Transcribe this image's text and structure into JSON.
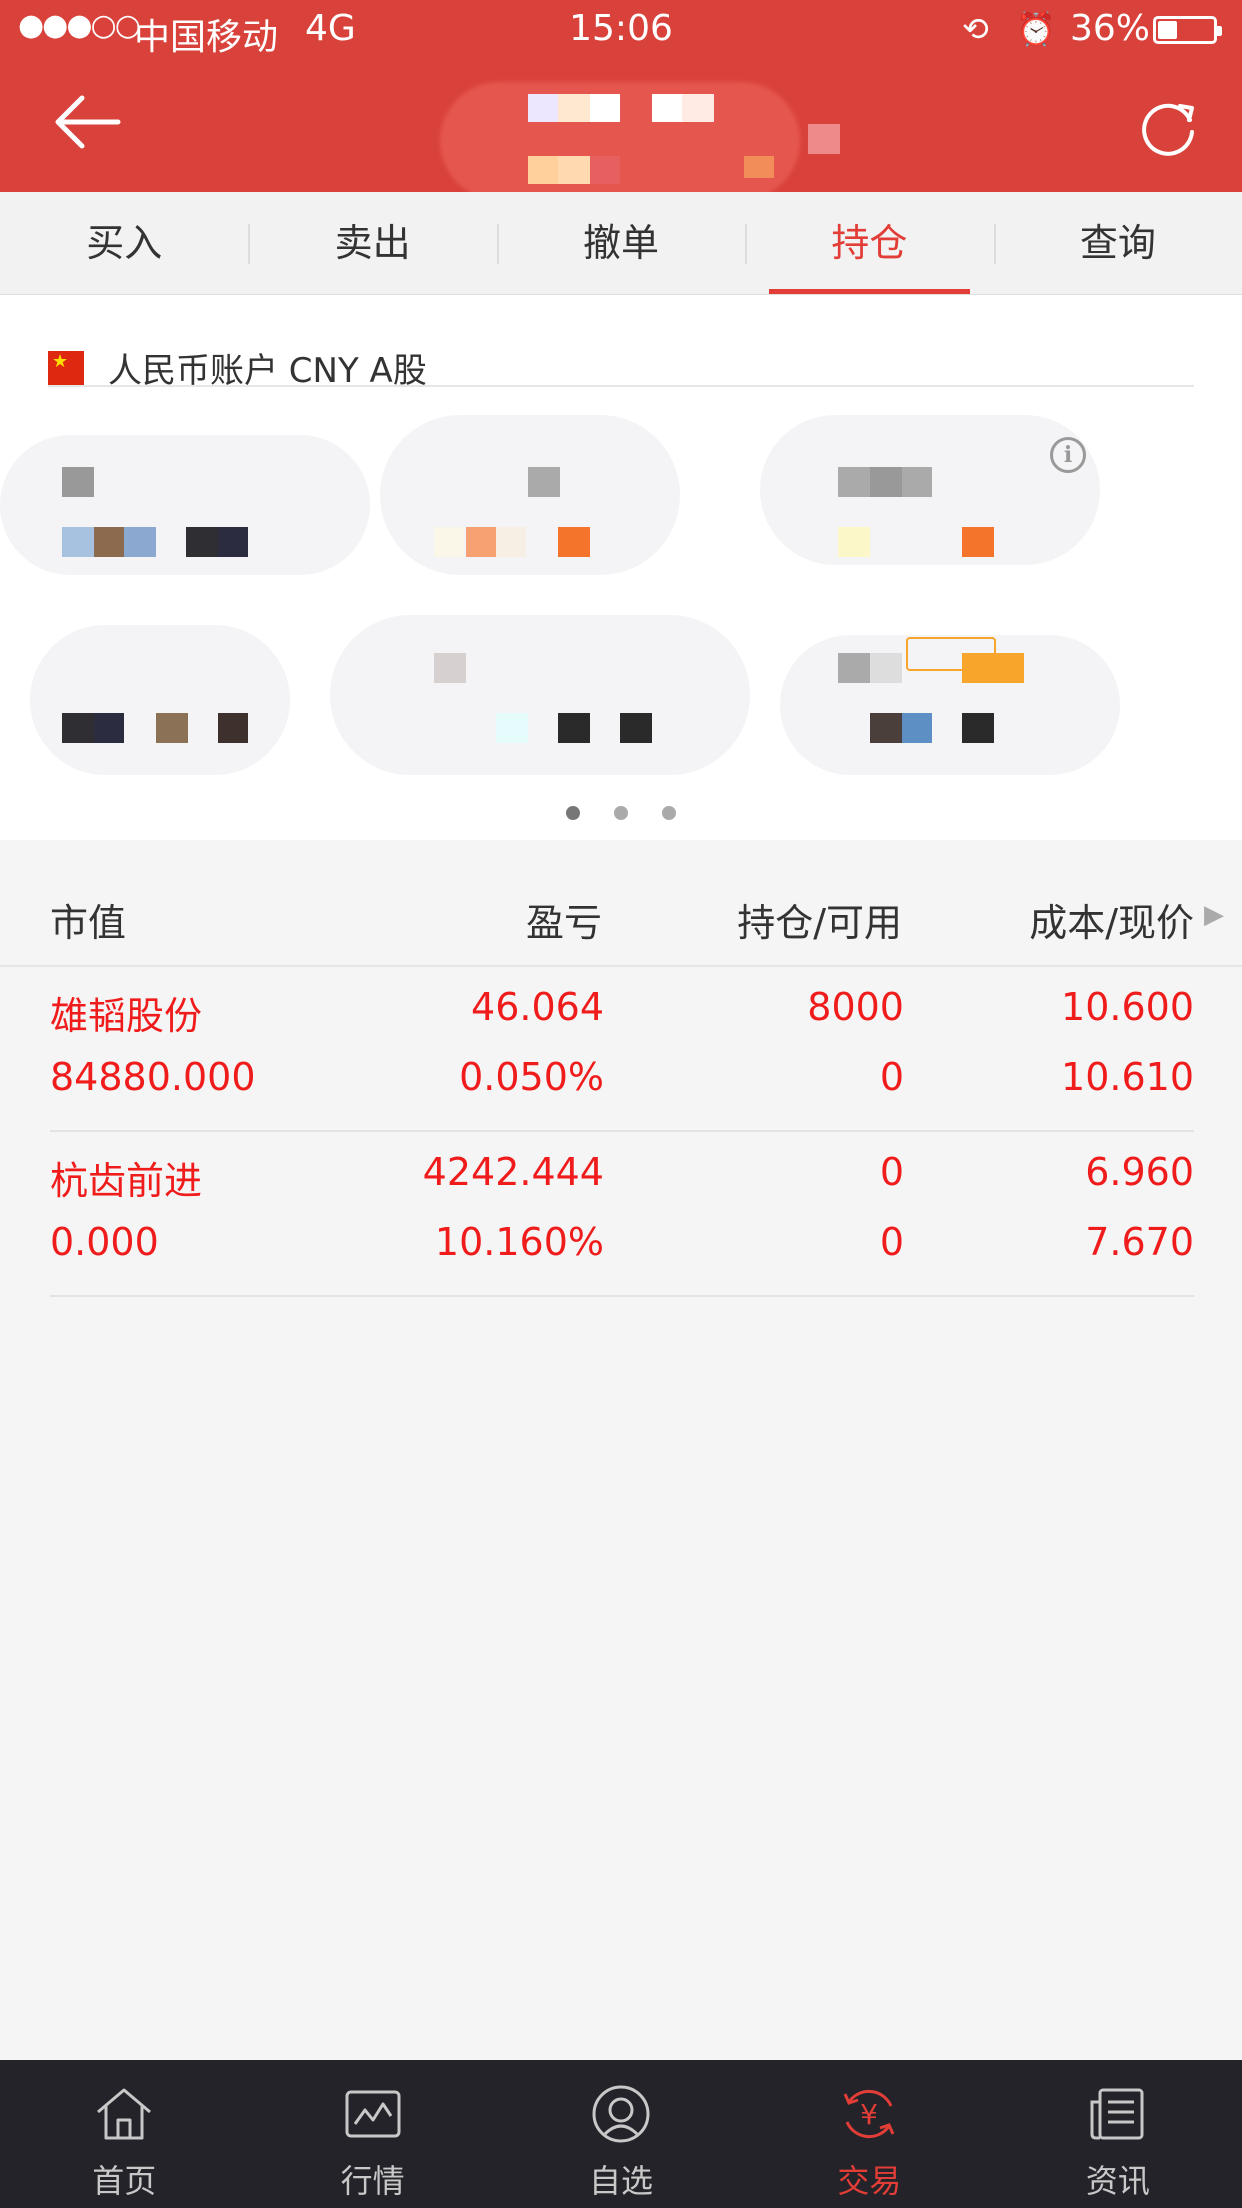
{
  "status_bar": {
    "signal": "●●●○○",
    "carrier": "中国移动",
    "network": "4G",
    "time": "15:06",
    "battery_percent": "36%",
    "battery_level": 0.36
  },
  "tabs": [
    {
      "label": "买入"
    },
    {
      "label": "卖出"
    },
    {
      "label": "撤单"
    },
    {
      "label": "持仓",
      "active": true
    },
    {
      "label": "查询"
    }
  ],
  "account": {
    "label": "人民币账户 CNY A股",
    "page_count": 3,
    "active_page": 1
  },
  "table": {
    "headers": [
      "市值",
      "盈亏",
      "持仓/可用",
      "成本/现价"
    ],
    "rows": [
      {
        "name": "雄韬股份",
        "market_value": "84880.000",
        "pnl": "46.064",
        "pnl_pct": "0.050%",
        "position": "8000",
        "available": "0",
        "cost": "10.600",
        "price": "10.610"
      },
      {
        "name": "杭齿前进",
        "market_value": "0.000",
        "pnl": "4242.444",
        "pnl_pct": "10.160%",
        "position": "0",
        "available": "0",
        "cost": "6.960",
        "price": "7.670"
      }
    ]
  },
  "tabbar": [
    {
      "label": "首页",
      "icon": "home-icon"
    },
    {
      "label": "行情",
      "icon": "chart-icon"
    },
    {
      "label": "自选",
      "icon": "user-circle-icon"
    },
    {
      "label": "交易",
      "icon": "yuan-trade-icon",
      "active": true
    },
    {
      "label": "资讯",
      "icon": "news-icon"
    }
  ],
  "colors": {
    "brand_red": "#d9423b",
    "profit_red": "#f01c1c",
    "tabbar_bg": "#232329"
  }
}
